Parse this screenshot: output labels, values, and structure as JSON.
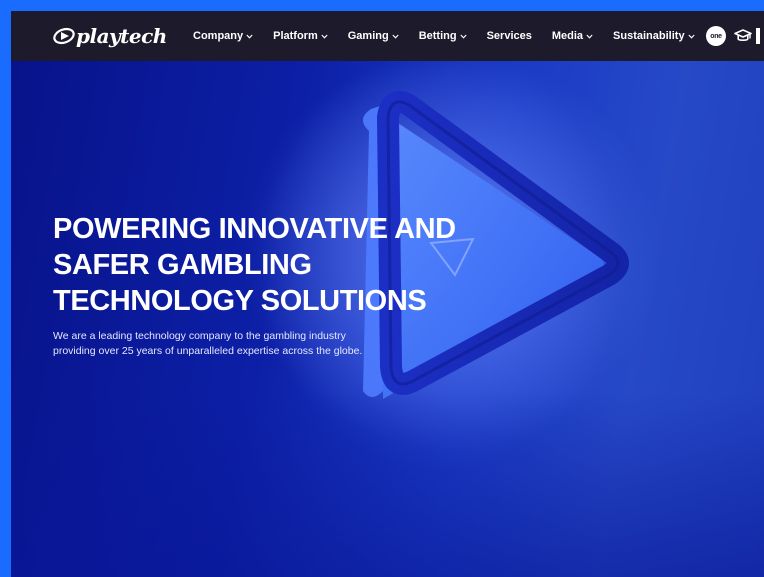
{
  "nav": {
    "logo_text": "playtech",
    "items": [
      {
        "label": "Company",
        "has_dropdown": true
      },
      {
        "label": "Platform",
        "has_dropdown": true
      },
      {
        "label": "Gaming",
        "has_dropdown": true
      },
      {
        "label": "Betting",
        "has_dropdown": true
      },
      {
        "label": "Services",
        "has_dropdown": false
      },
      {
        "label": "Media",
        "has_dropdown": true
      },
      {
        "label": "Sustainability",
        "has_dropdown": true
      }
    ],
    "one_badge": "one",
    "icons": [
      "chevron-down-icon",
      "graduation-cap-icon"
    ]
  },
  "hero": {
    "headline_lines": [
      "POWERING INNOVATIVE AND",
      "SAFER GAMBLING",
      "TECHNOLOGY SOLUTIONS"
    ],
    "subtext": "We are a leading technology company to the gambling industry providing over 25 years of unparalleled expertise across the globe."
  },
  "colors": {
    "nav_bg": "#1c1a2b",
    "hero_bg": "#0c1fa6",
    "accent_blue": "#1a6cff",
    "text": "#ffffff"
  }
}
